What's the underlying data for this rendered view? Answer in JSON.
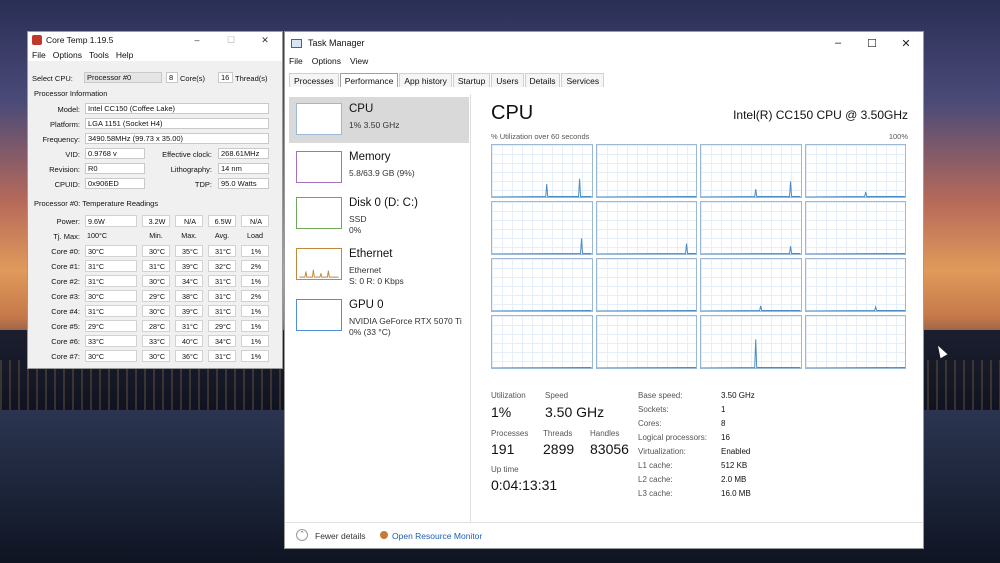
{
  "coretemp": {
    "title": "Core Temp 1.19.5",
    "controls": [
      "–",
      "☐",
      "✕"
    ],
    "menu": [
      "File",
      "Options",
      "Tools",
      "Help"
    ],
    "select_cpu_label": "Select CPU:",
    "select_cpu_value": "Processor #0",
    "cores_value": "8",
    "cores_label": "Core(s)",
    "threads_value": "16",
    "threads_label": "Thread(s)",
    "info_group": "Processor Information",
    "model_label": "Model:",
    "model": "Intel CC150 (Coffee Lake)",
    "platform_label": "Platform:",
    "platform": "LGA 1151 (Socket H4)",
    "frequency_label": "Frequency:",
    "frequency": "3490.58MHz (99.73 x 35.00)",
    "vid_label": "VID:",
    "vid": "0.9768 v",
    "eff_label": "Effective clock:",
    "eff": "268.61MHz",
    "revision_label": "Revision:",
    "revision": "R0",
    "litho_label": "Lithography:",
    "litho": "14 nm",
    "cpuid_label": "CPUID:",
    "cpuid": "0x906ED",
    "tdp_label": "TDP:",
    "tdp": "95.0 Watts",
    "temp_group": "Processor #0: Temperature Readings",
    "power_label": "Power:",
    "power_values": [
      "9.6W",
      "3.2W",
      "N/A",
      "6.5W",
      "N/A"
    ],
    "tjmax_label": "Tj. Max:",
    "tjmax": "100°C",
    "headers": [
      "Min.",
      "Max.",
      "Avg.",
      "Load"
    ],
    "cores": [
      {
        "name": "Core #0:",
        "temp": "30°C",
        "min": "30°C",
        "max": "35°C",
        "avg": "31°C",
        "load": "1%"
      },
      {
        "name": "Core #1:",
        "temp": "31°C",
        "min": "31°C",
        "max": "39°C",
        "avg": "32°C",
        "load": "2%"
      },
      {
        "name": "Core #2:",
        "temp": "31°C",
        "min": "30°C",
        "max": "34°C",
        "avg": "31°C",
        "load": "1%"
      },
      {
        "name": "Core #3:",
        "temp": "30°C",
        "min": "29°C",
        "max": "38°C",
        "avg": "31°C",
        "load": "2%"
      },
      {
        "name": "Core #4:",
        "temp": "31°C",
        "min": "30°C",
        "max": "39°C",
        "avg": "31°C",
        "load": "1%"
      },
      {
        "name": "Core #5:",
        "temp": "29°C",
        "min": "28°C",
        "max": "31°C",
        "avg": "29°C",
        "load": "1%"
      },
      {
        "name": "Core #6:",
        "temp": "33°C",
        "min": "33°C",
        "max": "40°C",
        "avg": "34°C",
        "load": "1%"
      },
      {
        "name": "Core #7:",
        "temp": "30°C",
        "min": "30°C",
        "max": "36°C",
        "avg": "31°C",
        "load": "1%"
      }
    ]
  },
  "taskmanager": {
    "title": "Task Manager",
    "controls": [
      "–",
      "☐",
      "✕"
    ],
    "menu": [
      "File",
      "Options",
      "View"
    ],
    "tabs": [
      "Processes",
      "Performance",
      "App history",
      "Startup",
      "Users",
      "Details",
      "Services"
    ],
    "active_tab": "Performance",
    "side": [
      {
        "name": "CPU",
        "sub1": "1% 3.50 GHz",
        "sub2": ""
      },
      {
        "name": "Memory",
        "sub1": "5.8/63.9 GB (9%)",
        "sub2": ""
      },
      {
        "name": "Disk 0 (D: C:)",
        "sub1": "SSD",
        "sub2": "0%"
      },
      {
        "name": "Ethernet",
        "sub1": "Ethernet",
        "sub2": "S: 0 R: 0 Kbps"
      },
      {
        "name": "GPU 0",
        "sub1": "NVIDIA GeForce RTX 5070 Ti",
        "sub2": "0% (33 °C)"
      }
    ],
    "main": {
      "heading": "CPU",
      "cpu_name": "Intel(R) CC150 CPU @ 3.50GHz",
      "util_label": "% Utilization over 60 seconds",
      "util_max": "100%",
      "utilization_label": "Utilization",
      "utilization": "1%",
      "speed_label": "Speed",
      "speed": "3.50 GHz",
      "processes_label": "Processes",
      "processes": "191",
      "threads_label": "Threads",
      "threads": "2899",
      "handles_label": "Handles",
      "handles": "83056",
      "uptime_label": "Up time",
      "uptime": "0:04:13:31",
      "specs": [
        {
          "label": "Base speed:",
          "value": "3.50 GHz"
        },
        {
          "label": "Sockets:",
          "value": "1"
        },
        {
          "label": "Cores:",
          "value": "8"
        },
        {
          "label": "Logical processors:",
          "value": "16"
        },
        {
          "label": "Virtualization:",
          "value": "Enabled"
        },
        {
          "label": "L1 cache:",
          "value": "512 KB"
        },
        {
          "label": "L2 cache:",
          "value": "2.0 MB"
        },
        {
          "label": "L3 cache:",
          "value": "16.0 MB"
        }
      ]
    },
    "footer": {
      "fewer": "Fewer details",
      "monitor": "Open Resource Monitor"
    }
  },
  "colors": {
    "graph_line": "#4a8cc7",
    "selected": "#d9d9d9"
  }
}
